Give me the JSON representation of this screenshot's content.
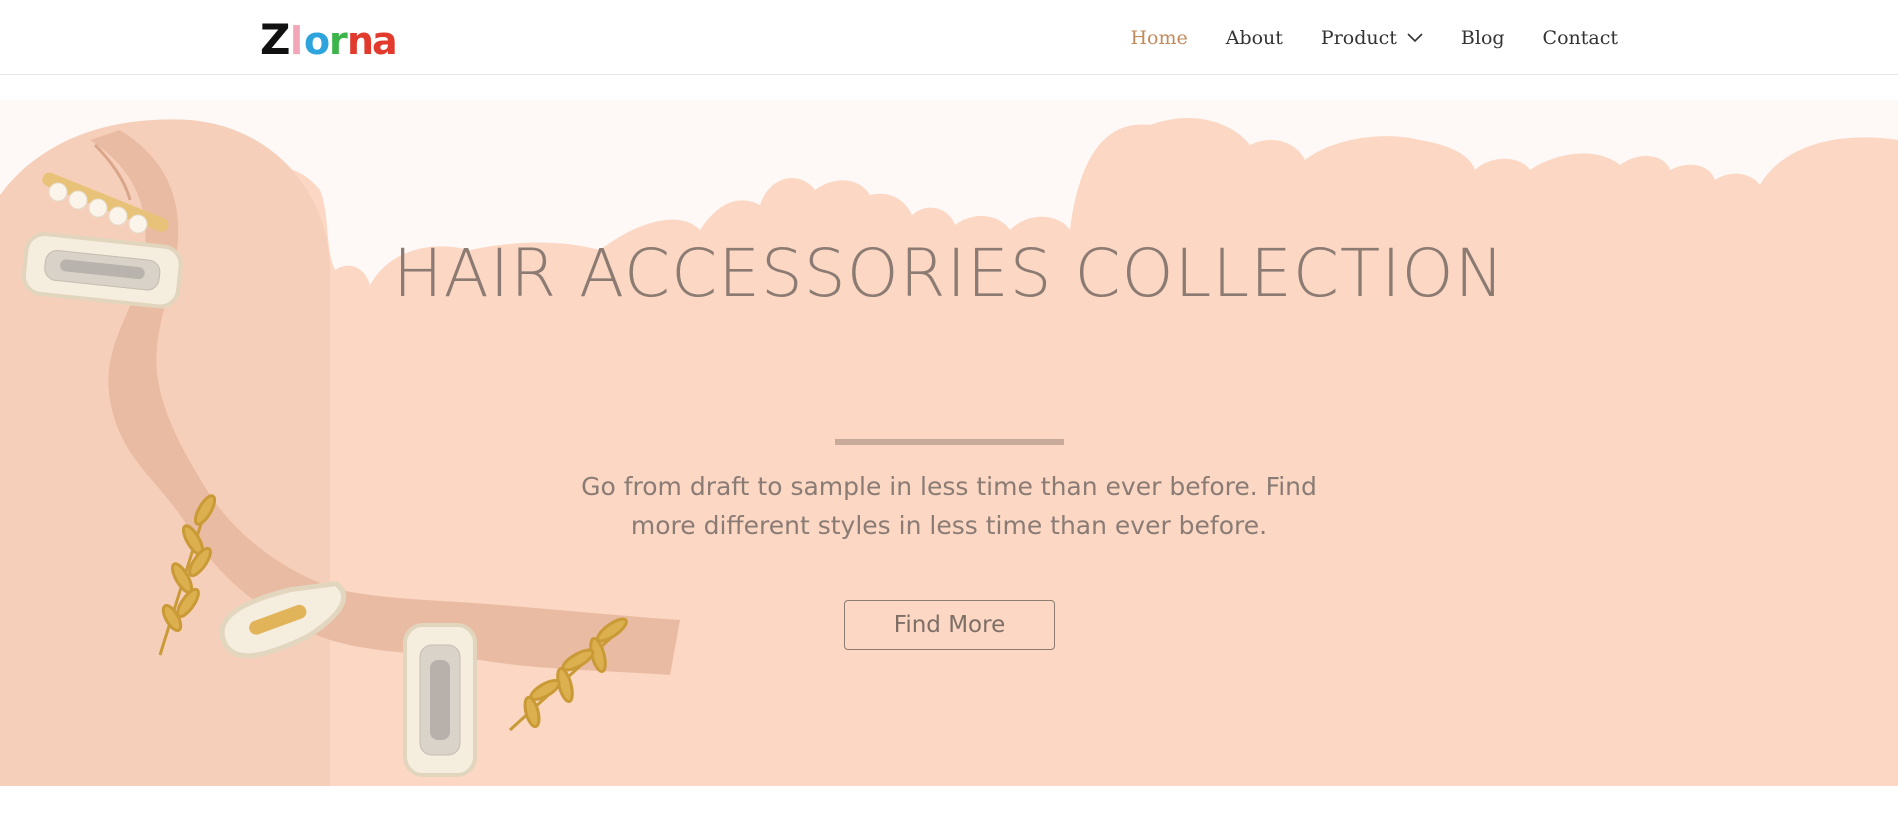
{
  "header": {
    "logo": {
      "letters": [
        {
          "char": "Z",
          "color": "#111111"
        },
        {
          "char": "l",
          "color": "#f2a7b8"
        },
        {
          "char": "o",
          "color": "#2ea4dd"
        },
        {
          "char": "r",
          "color": "#3bb44a"
        },
        {
          "char": "n",
          "color": "#e23b2e"
        },
        {
          "char": "a",
          "color": "#e23b2e"
        }
      ]
    },
    "nav": [
      {
        "label": "Home",
        "active": true
      },
      {
        "label": "About",
        "active": false
      },
      {
        "label": "Product",
        "active": false,
        "has_dropdown": true,
        "icon": "chevron-down-icon"
      },
      {
        "label": "Blog",
        "active": false
      },
      {
        "label": "Contact",
        "active": false
      }
    ],
    "active_color": "#c28a5a"
  },
  "hero": {
    "title": "HAIR ACCESSORIES COLLECTION",
    "text": "Go from draft to sample in less time than ever before. Find more different styles in less time than ever before.",
    "button_label": "Find More",
    "background_color": "#fcd9c6",
    "title_color": "#8c7b72"
  }
}
